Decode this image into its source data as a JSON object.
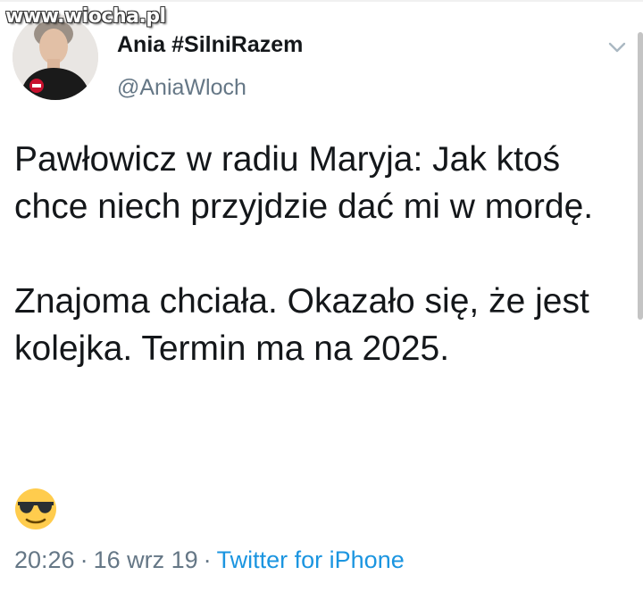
{
  "watermark": "www.wiocha.pl",
  "author": {
    "name": "Ania #SilniRazem",
    "handle": "@AniaWloch"
  },
  "tweet": {
    "paragraph1": "Pawłowicz w radiu Maryja: Jak ktoś chce niech przyjdzie dać mi w mordę.",
    "paragraph2": "Znajoma chciała. Okazało się, że jest kolejka. Termin ma na 2025."
  },
  "emoji": "sunglasses-face",
  "meta": {
    "time": "20:26",
    "date": "16 wrz 19",
    "separator": "·",
    "source": "Twitter for iPhone"
  },
  "colors": {
    "text": "#14171a",
    "secondary": "#657786",
    "link": "#1b95e0"
  }
}
